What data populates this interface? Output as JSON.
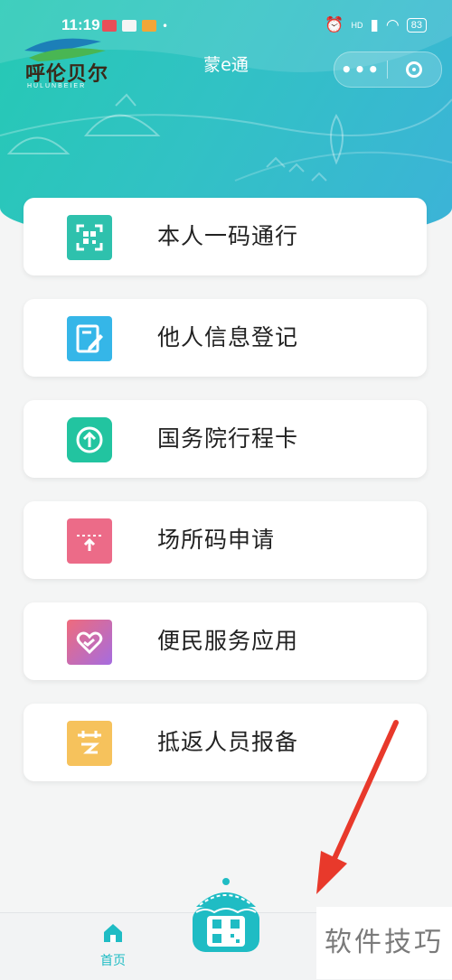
{
  "status_bar": {
    "time": "11:19",
    "battery": "83",
    "network": "HD"
  },
  "header": {
    "title": "蒙e通",
    "more_label": "•••",
    "logo_text": "呼伦贝尔",
    "logo_sub": "HULUNBEIER"
  },
  "colors": {
    "banner_start": "#25c9b4",
    "banner_end": "#3cb3d8",
    "accent": "#1fbcc4",
    "arrow_red": "#e8392b"
  },
  "menu": [
    {
      "label": "本人一码通行",
      "icon": "scan-qr-icon",
      "color": "#2ec1ad"
    },
    {
      "label": "他人信息登记",
      "icon": "edit-form-icon",
      "color": "#35b6e8"
    },
    {
      "label": "国务院行程卡",
      "icon": "arrow-up-circle-icon",
      "color": "#22c4a0"
    },
    {
      "label": "场所码申请",
      "icon": "ticket-upload-icon",
      "color": "#ec6b88"
    },
    {
      "label": "便民服务应用",
      "icon": "heart-hand-icon",
      "color": "#d96aa8"
    },
    {
      "label": "抵返人员报备",
      "icon": "calendar-plane-icon",
      "color": "#f6c25c"
    }
  ],
  "tabbar": {
    "home_label": "首页"
  },
  "watermark": "软件技巧"
}
